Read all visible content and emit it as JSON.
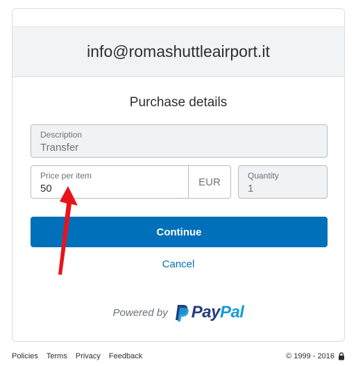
{
  "merchant": {
    "email": "info@romashuttleairport.it"
  },
  "purchase": {
    "title": "Purchase details",
    "description_label": "Description",
    "description_value": "Transfer",
    "price_label": "Price per item",
    "price_value": "50",
    "currency": "EUR",
    "quantity_label": "Quantity",
    "quantity_value": "1"
  },
  "actions": {
    "continue_label": "Continue",
    "cancel_label": "Cancel"
  },
  "branding": {
    "powered_by": "Powered by",
    "wordmark_pay": "Pay",
    "wordmark_pal": "Pal"
  },
  "footer": {
    "links": [
      "Policies",
      "Terms",
      "Privacy",
      "Feedback"
    ],
    "copyright": "© 1999 - 2016"
  },
  "colors": {
    "accent": "#0070ba",
    "paypal_dark": "#253b80",
    "paypal_light": "#179bd7",
    "annotation": "#e8141b"
  },
  "icons": {
    "lock": "lock-icon",
    "paypal": "paypal-logo-icon"
  }
}
